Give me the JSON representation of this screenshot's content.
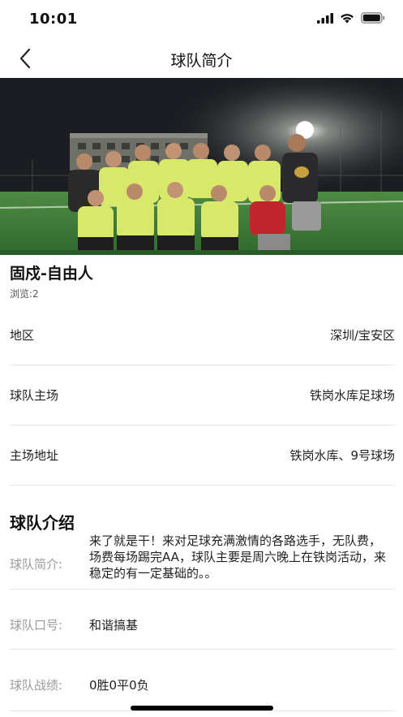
{
  "status_bar": {
    "time": "10:01"
  },
  "nav": {
    "title": "球队简介"
  },
  "team": {
    "name": "固戍-自由人",
    "views_label": "浏览:",
    "views_count": "2"
  },
  "info_rows": [
    {
      "label": "地区",
      "value": "深圳/宝安区"
    },
    {
      "label": "球队主场",
      "value": "铁岗水库足球场"
    },
    {
      "label": "主场地址",
      "value": "铁岗水库、9号球场"
    }
  ],
  "intro_section": {
    "title": "球队介绍",
    "brief_label": "球队简介:",
    "brief_text": "来了就是干！来对足球充满激情的各路选手，无队费，场费每场踢完AA，球队主要是周六晚上在铁岗活动，来稳定的有一定基础的。。",
    "slogan_label": "球队口号:",
    "slogan_text": "和谐搞基",
    "record_label": "球队战绩:",
    "record_text": "0胜0平0负"
  },
  "colors": {
    "jersey": "#d8e86a",
    "field": "#3f7a3a",
    "sky": "#1b1d22"
  }
}
